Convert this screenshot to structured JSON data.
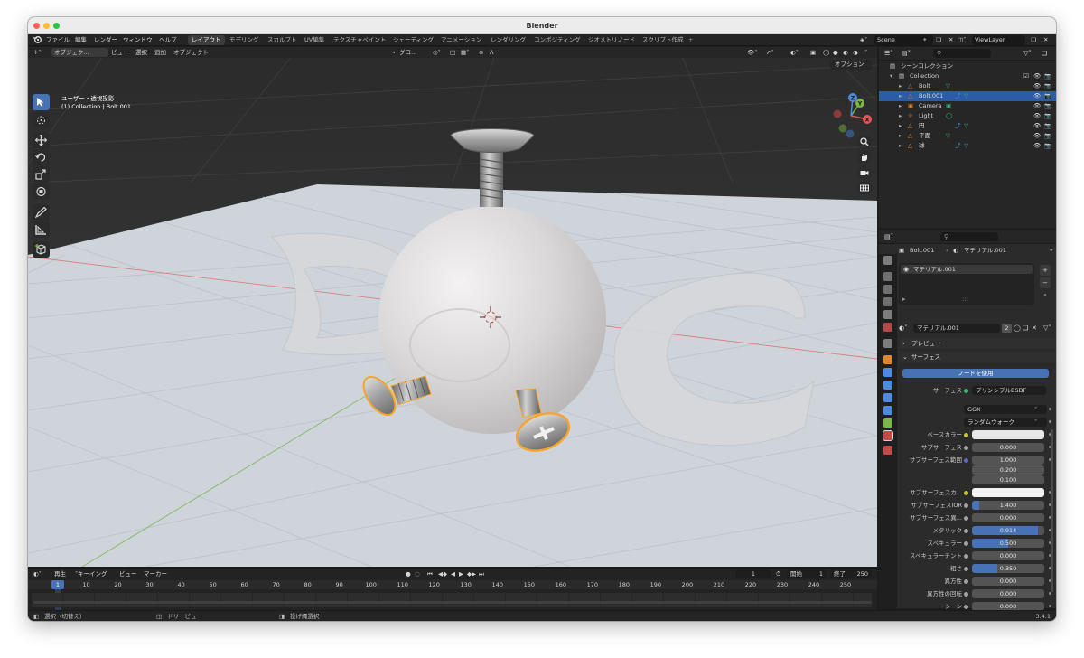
{
  "window": {
    "title": "Blender",
    "version": "3.4.1"
  },
  "menu": [
    "ファイル",
    "編集",
    "レンダー",
    "ウィンドウ",
    "ヘルプ"
  ],
  "workspaces": [
    "レイアウト",
    "モデリング",
    "スカルプト",
    "UV編集",
    "テクスチャペイント",
    "シェーディング",
    "アニメーション",
    "レンダリング",
    "コンポジティング",
    "ジオメトリノード",
    "スクリプト作成"
  ],
  "active_workspace": "レイアウト",
  "scene_selector": "Scene",
  "view_layer": "ViewLayer",
  "viewport": {
    "mode": "オブジェク...",
    "header_menus": [
      "ビュー",
      "選択",
      "追加",
      "オブジェクト"
    ],
    "transform_orientation": "グロ...",
    "options_label": "オプション",
    "overlay_view": "ユーザー・透視投影",
    "overlay_collection": "(1) Collection | Bolt.001",
    "gizmo_axes": [
      "X",
      "Y",
      "Z"
    ]
  },
  "outliner": {
    "root": "シーンコレクション",
    "collection": "Collection",
    "items": [
      {
        "label": "Bolt",
        "selected": false
      },
      {
        "label": "Bolt.001",
        "selected": true
      },
      {
        "label": "Camera",
        "selected": false
      },
      {
        "label": "Light",
        "selected": false
      },
      {
        "label": "円",
        "selected": false
      },
      {
        "label": "平面",
        "selected": false
      },
      {
        "label": "球",
        "selected": false
      }
    ]
  },
  "properties": {
    "breadcrumb_object": "Bolt.001",
    "breadcrumb_material": "マテリアル.001",
    "material_slot": "マテリアル.001",
    "material_name": "マテリアル.001",
    "user_count": "2",
    "panel_preview": "プレビュー",
    "panel_surface": "サーフェス",
    "use_nodes_button": "ノードを使用",
    "surface_label": "サーフェス",
    "surface_shader": "プリンシプルBSDF",
    "distribution": "GGX",
    "subsurface_method": "ランダムウォーク",
    "rows": [
      {
        "label": "ベースカラー",
        "kind": "color",
        "color": "#e8e8e8"
      },
      {
        "label": "サブサーフェス",
        "kind": "value",
        "value": "0.000",
        "fill": 0
      },
      {
        "label": "サブサーフェス範囲",
        "kind": "vector",
        "values": [
          "1.000",
          "0.200",
          "0.100"
        ]
      },
      {
        "label": "サブサーフェスカ...",
        "kind": "color",
        "color": "#f2f2f2"
      },
      {
        "label": "サブサーフェスIOR",
        "kind": "value",
        "value": "1.400",
        "fill": 0.1
      },
      {
        "label": "サブサーフェス異...",
        "kind": "value",
        "value": "0.000",
        "fill": 0
      },
      {
        "label": "メタリック",
        "kind": "value",
        "value": "0.914",
        "fill": 0.914
      },
      {
        "label": "スペキュラー",
        "kind": "value",
        "value": "0.500",
        "fill": 0.5
      },
      {
        "label": "スペキュラーチント",
        "kind": "value",
        "value": "0.000",
        "fill": 0
      },
      {
        "label": "粗さ",
        "kind": "value",
        "value": "0.350",
        "fill": 0.35
      },
      {
        "label": "異方性",
        "kind": "value",
        "value": "0.000",
        "fill": 0
      },
      {
        "label": "異方性の回転",
        "kind": "value",
        "value": "0.000",
        "fill": 0
      },
      {
        "label": "シーン",
        "kind": "value",
        "value": "0.000",
        "fill": 0
      },
      {
        "label": "シーンチント",
        "kind": "value",
        "value": "0.500",
        "fill": 0.5
      }
    ]
  },
  "timeline": {
    "menus": [
      "再生",
      "キーイング",
      "ビュー",
      "マーカー"
    ],
    "current_frame": "1",
    "start_label": "開始",
    "start": "1",
    "end_label": "終了",
    "end": "250",
    "ruler": [
      "1",
      "10",
      "20",
      "30",
      "40",
      "50",
      "60",
      "70",
      "80",
      "90",
      "100",
      "110",
      "120",
      "130",
      "140",
      "150",
      "160",
      "170",
      "180",
      "190",
      "200",
      "210",
      "220",
      "230",
      "240",
      "250"
    ]
  },
  "status": {
    "select": "選択（切替え）",
    "dolly": "ドリービュー",
    "lasso": "投げ縄選択"
  },
  "colors": {
    "accent": "#4772b3",
    "selection": "#f5a52b",
    "x_axis": "#e0565b",
    "y_axis": "#7ab744",
    "z_axis": "#4d8be0"
  }
}
